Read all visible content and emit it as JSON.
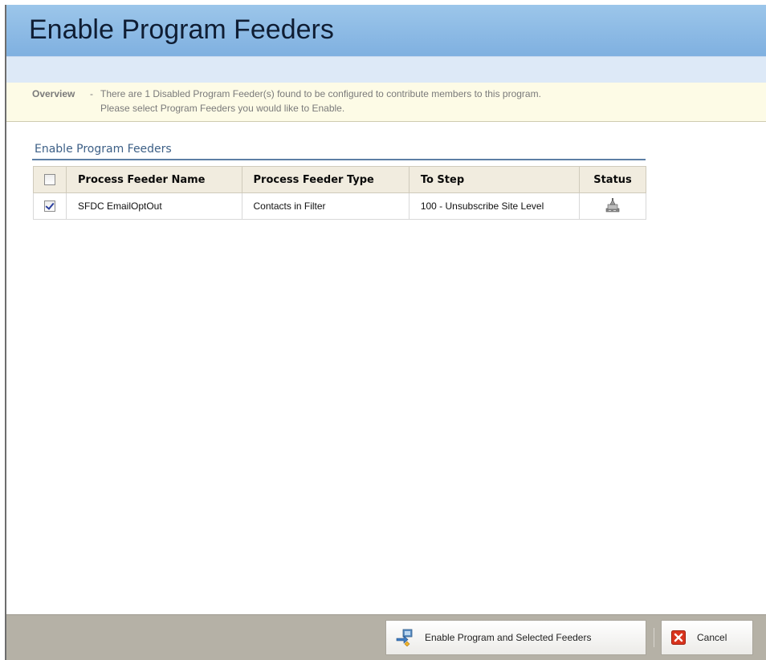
{
  "title": "Enable Program Feeders",
  "overview": {
    "label": "Overview",
    "dash": "-",
    "line1": "There are 1 Disabled Program Feeder(s) found to be configured to contribute members to this program.",
    "line2": "Please select Program Feeders you would like to Enable."
  },
  "section_title": "Enable Program Feeders",
  "table": {
    "headers": {
      "name": "Process Feeder Name",
      "type": "Process Feeder Type",
      "step": "To Step",
      "status": "Status"
    },
    "select_all_checked": false,
    "rows": [
      {
        "checked": true,
        "name": "SFDC EmailOptOut",
        "type": "Contacts in Filter",
        "step": "100 - Unsubscribe Site Level",
        "status_icon": "disabled-feeder-icon"
      }
    ]
  },
  "footer": {
    "enable_label": "Enable Program and Selected Feeders",
    "enable_icon": "enable-feeders-icon",
    "cancel_label": "Cancel",
    "cancel_icon": "cancel-x-icon"
  },
  "colors": {
    "title_bar": "#8ebbe6",
    "sub_bar": "#dde9f7",
    "overview_bg": "#fdfbe6",
    "section_title": "#3c5f86",
    "header_bg": "#f1ecdf",
    "footer_bg": "#b5b1a6",
    "cancel_red": "#d9341e"
  }
}
